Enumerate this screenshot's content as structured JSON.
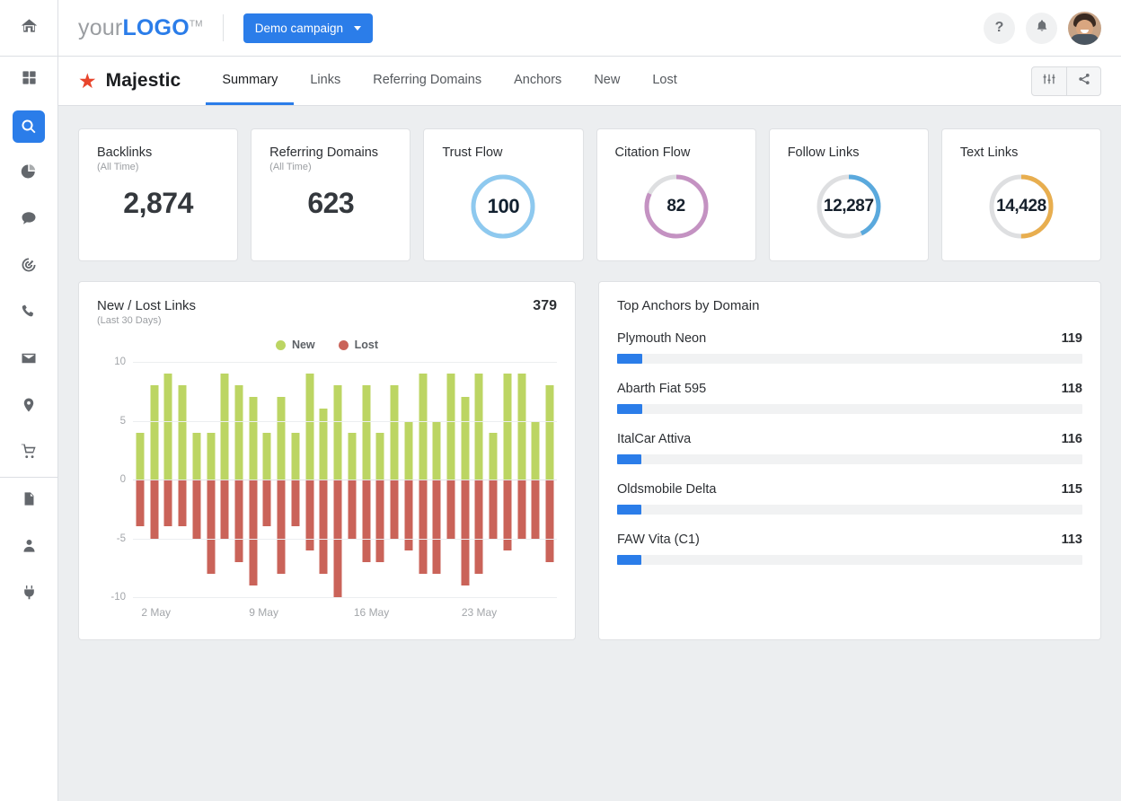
{
  "colors": {
    "accent": "#2b7de9",
    "new": "#bcd563",
    "lost": "#ca6359",
    "trust_flow": "#8ec9ef",
    "citation_flow": "#c492c2",
    "follow_links": "#5aa9dd",
    "text_links": "#e8ae4f",
    "track": "#dedfe1"
  },
  "rail": {
    "items": [
      {
        "icon": "home-icon",
        "name": "home"
      },
      {
        "icon": "grid-icon",
        "name": "dashboard"
      },
      {
        "icon": "search-icon",
        "name": "search",
        "active": true
      },
      {
        "icon": "pie-chart-icon",
        "name": "analytics"
      },
      {
        "icon": "chat-icon",
        "name": "messages"
      },
      {
        "icon": "target-icon",
        "name": "goals"
      },
      {
        "icon": "phone-icon",
        "name": "calls"
      },
      {
        "icon": "envelope-icon",
        "name": "email"
      },
      {
        "icon": "map-pin-icon",
        "name": "locations"
      },
      {
        "icon": "cart-icon",
        "name": "ecommerce"
      },
      {
        "icon": "report-icon",
        "name": "reports"
      },
      {
        "icon": "user-icon",
        "name": "account"
      },
      {
        "icon": "plug-icon",
        "name": "integrations"
      }
    ]
  },
  "topbar": {
    "logo_light": "your",
    "logo_bold": "LOGO",
    "logo_tm": "TM",
    "campaign_label": "Demo campaign",
    "help_icon": "?",
    "bell_icon": "notification-bell-icon",
    "avatar": "user-avatar"
  },
  "tabbar": {
    "brand": "Majestic",
    "star_icon": "star-icon",
    "tabs": [
      {
        "label": "Summary",
        "active": true
      },
      {
        "label": "Links",
        "active": false
      },
      {
        "label": "Referring Domains",
        "active": false
      },
      {
        "label": "Anchors",
        "active": false
      },
      {
        "label": "New",
        "active": false
      },
      {
        "label": "Lost",
        "active": false
      }
    ],
    "settings_icon": "sliders-icon",
    "share_icon": "share-icon"
  },
  "kpis": [
    {
      "title": "Backlinks",
      "sub": "(All Time)",
      "value": "2,874",
      "type": "number"
    },
    {
      "title": "Referring Domains",
      "sub": "(All Time)",
      "value": "623",
      "type": "number"
    },
    {
      "title": "Trust Flow",
      "sub": "",
      "value": "100",
      "type": "donut",
      "percent": 100,
      "color": "#8ec9ef"
    },
    {
      "title": "Citation Flow",
      "sub": "",
      "value": "82",
      "type": "donut",
      "percent": 82,
      "color": "#c492c2"
    },
    {
      "title": "Follow Links",
      "sub": "",
      "value": "12,287",
      "type": "donut",
      "percent": 43,
      "color": "#5aa9dd"
    },
    {
      "title": "Text Links",
      "sub": "",
      "value": "14,428",
      "type": "donut",
      "percent": 50,
      "color": "#e8ae4f"
    }
  ],
  "new_lost_panel": {
    "title": "New / Lost Links",
    "sub": "(Last 30 Days)",
    "total": "379",
    "legend": [
      {
        "label": "New",
        "color": "#bcd563"
      },
      {
        "label": "Lost",
        "color": "#ca6359"
      }
    ]
  },
  "anchors_panel": {
    "title": "Top Anchors by Domain",
    "max": 2200,
    "items": [
      {
        "label": "Plymouth Neon",
        "value": "119",
        "bar": 119
      },
      {
        "label": "Abarth Fiat 595",
        "value": "118",
        "bar": 118
      },
      {
        "label": "ItalCar Attiva",
        "value": "116",
        "bar": 116
      },
      {
        "label": "Oldsmobile Delta",
        "value": "115",
        "bar": 115
      },
      {
        "label": "FAW Vita (C1)",
        "value": "113",
        "bar": 113
      }
    ]
  },
  "chart_data": {
    "type": "bar",
    "title": "New / Lost Links",
    "subtitle": "(Last 30 Days)",
    "xlabel": "",
    "ylabel": "",
    "ylim": [
      -10,
      10
    ],
    "yticks": [
      10,
      5,
      0,
      -5,
      -10
    ],
    "ytick_labels": [
      "10",
      "5",
      "0",
      "-5",
      "-10"
    ],
    "grid": true,
    "legend_position": "top-center",
    "stacked_diverging": true,
    "x": [
      "1 May",
      "2 May",
      "3 May",
      "4 May",
      "5 May",
      "6 May",
      "7 May",
      "8 May",
      "9 May",
      "10 May",
      "11 May",
      "12 May",
      "13 May",
      "14 May",
      "15 May",
      "16 May",
      "17 May",
      "18 May",
      "19 May",
      "20 May",
      "21 May",
      "22 May",
      "23 May",
      "24 May",
      "25 May",
      "26 May",
      "27 May",
      "28 May",
      "29 May",
      "30 May"
    ],
    "xtick_labels": [
      "2 May",
      "9 May",
      "16 May",
      "23 May"
    ],
    "xtick_indices": [
      1,
      8,
      15,
      22
    ],
    "series": [
      {
        "name": "New",
        "color": "#bcd563",
        "values": [
          4,
          8,
          9,
          8,
          4,
          4,
          9,
          8,
          7,
          4,
          7,
          4,
          9,
          6,
          8,
          4,
          8,
          4,
          8,
          5,
          9,
          5,
          9,
          7,
          9,
          4,
          9,
          9,
          5,
          8
        ]
      },
      {
        "name": "Lost",
        "color": "#ca6359",
        "values": [
          -4,
          -5,
          -4,
          -4,
          -5,
          -8,
          -5,
          -7,
          -9,
          -4,
          -8,
          -4,
          -6,
          -8,
          -10,
          -5,
          -7,
          -7,
          -5,
          -6,
          -8,
          -8,
          -5,
          -9,
          -8,
          -5,
          -6,
          -5,
          -5,
          -7
        ]
      }
    ]
  }
}
